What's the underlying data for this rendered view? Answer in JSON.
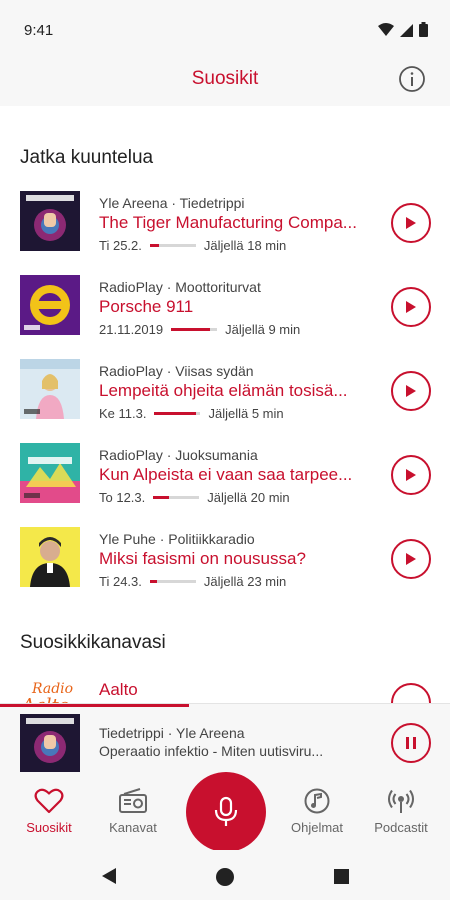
{
  "status_bar": {
    "time": "9:41"
  },
  "app_bar": {
    "title": "Suosikit",
    "info_icon": "info-icon"
  },
  "continue_listening": {
    "title": "Jatka kuuntelua",
    "items": [
      {
        "meta": "Yle Areena · Tiedetrippi",
        "title": "The Tiger Manufacturing Compa...",
        "date": "Ti 25.2.",
        "remaining": "Jäljellä 18 min",
        "progress": 0.2
      },
      {
        "meta": "RadioPlay · Moottoriturvat",
        "title": "Porsche 911",
        "date": "21.11.2019",
        "remaining": "Jäljellä 9 min",
        "progress": 0.85
      },
      {
        "meta": "RadioPlay · Viisas sydän",
        "title": "Lempeitä ohjeita elämän tosisä...",
        "date": "Ke 11.3.",
        "remaining": "Jäljellä 5 min",
        "progress": 0.9
      },
      {
        "meta": "RadioPlay · Juoksumania",
        "title": "Kun Alpeista ei vaan saa tarpee...",
        "date": "To 12.3.",
        "remaining": "Jäljellä 20 min",
        "progress": 0.35
      },
      {
        "meta": "Yle Puhe · Politiikkaradio",
        "title": "Miksi fasismi on nousussa?",
        "date": "Ti 24.3.",
        "remaining": "Jäljellä 23 min",
        "progress": 0.15
      }
    ]
  },
  "favorite_channels": {
    "title": "Suosikkikanavasi",
    "items": [
      {
        "name": "Aalto",
        "logo_text": "Radio Aalto"
      }
    ]
  },
  "mini_player": {
    "meta": "Tiedetrippi · Yle Areena",
    "title": "Operaatio infektio - Miten uutisviru...",
    "progress": 0.42
  },
  "bottom_nav": {
    "items": [
      {
        "label": "Suosikit",
        "icon": "heart-icon",
        "active": true
      },
      {
        "label": "Kanavat",
        "icon": "radio-icon",
        "active": false
      },
      {
        "label": "Ohjelmat",
        "icon": "music-note-icon",
        "active": false
      },
      {
        "label": "Podcastit",
        "icon": "podcast-icon",
        "active": false
      }
    ]
  },
  "colors": {
    "accent": "#c8102e",
    "background": "#ffffff",
    "bar_background": "#f7f7f7"
  }
}
